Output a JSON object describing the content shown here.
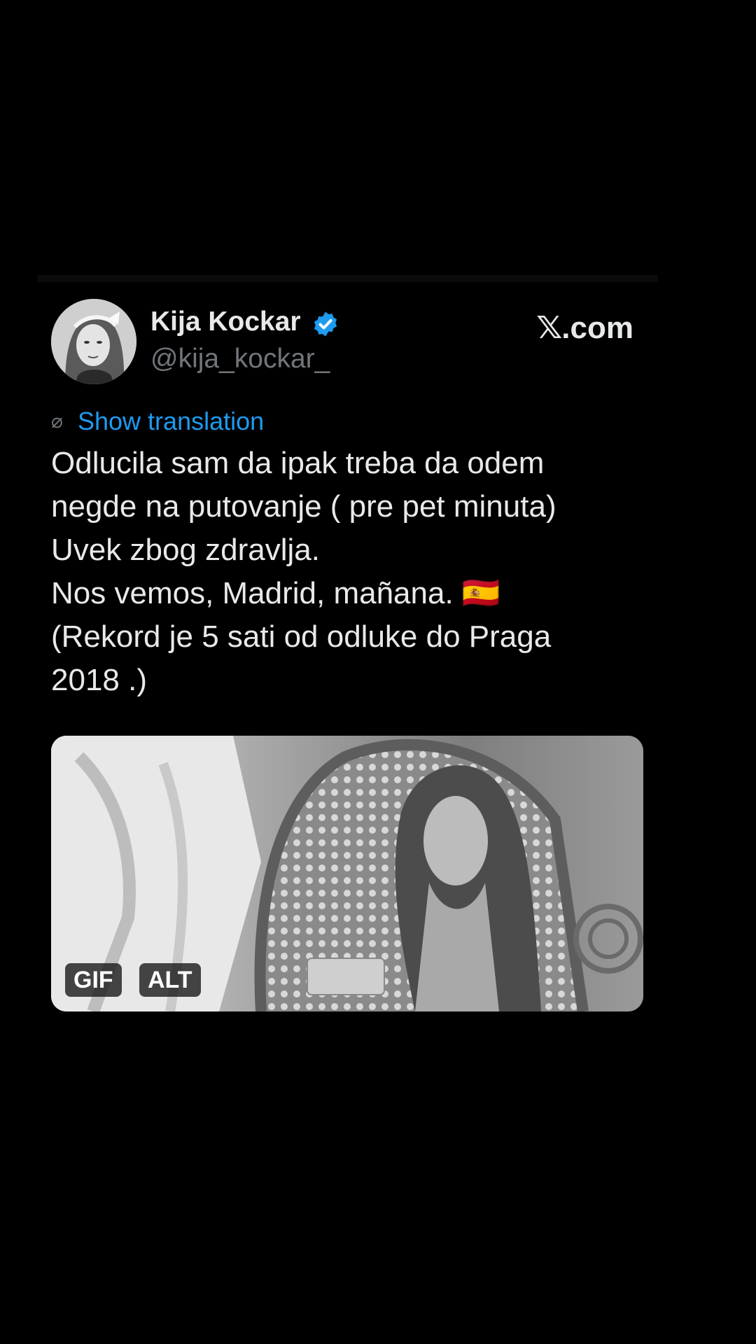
{
  "tweet": {
    "author": {
      "display_name": "Kija Kockar",
      "handle": "@kija_kockar_",
      "verified": true
    },
    "source_label": ".com",
    "source_logo": "x-logo",
    "translate_label": "Show translation",
    "text": "Odlucila sam da ipak treba da odem\nnegde na putovanje ( pre pet minuta)\nUvek zbog zdravlja.\nNos vemos, Madrid, mañana. 🇪🇸\n(Rekord je 5 sati od odluke do Praga\n2018 .)",
    "media": {
      "badges": [
        "GIF",
        "ALT"
      ]
    }
  },
  "colors": {
    "background": "#000000",
    "text_primary": "#e7e9ea",
    "text_secondary": "#71767b",
    "link": "#1d9bf0",
    "verified": "#1d9bf0"
  }
}
